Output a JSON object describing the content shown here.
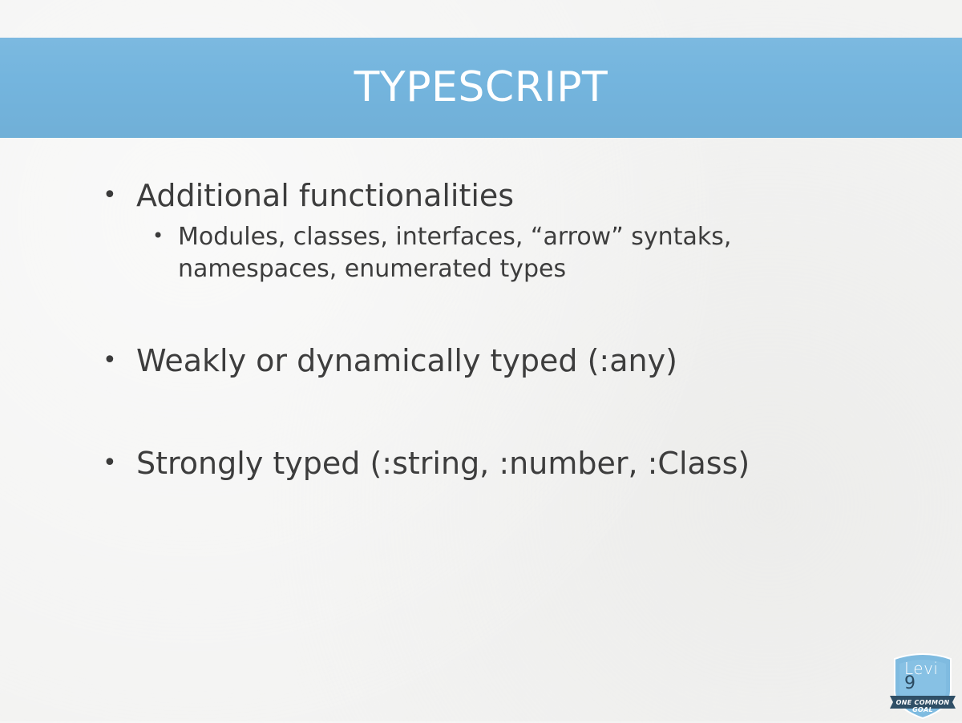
{
  "slide": {
    "title": "TYPESCRIPT",
    "bullets": [
      {
        "symbol": "•",
        "text": "Additional functionalities",
        "sub": [
          {
            "symbol": "•",
            "text": "Modules, classes, interfaces, “arrow” syntaks, namespaces, enumerated types"
          }
        ]
      },
      {
        "symbol": "•",
        "text": "Weakly or dynamically typed (:any)"
      },
      {
        "symbol": "•",
        "text": "Strongly typed (:string, :number, :Class)"
      }
    ]
  },
  "logo": {
    "brand": "Levi",
    "brand_number": "9",
    "tagline": "ONE COMMON GOAL"
  },
  "colors": {
    "title_band": "#74b5de",
    "title_text": "#ffffff",
    "body_text": "#3d3d3d",
    "background": "#f3f3f2"
  }
}
